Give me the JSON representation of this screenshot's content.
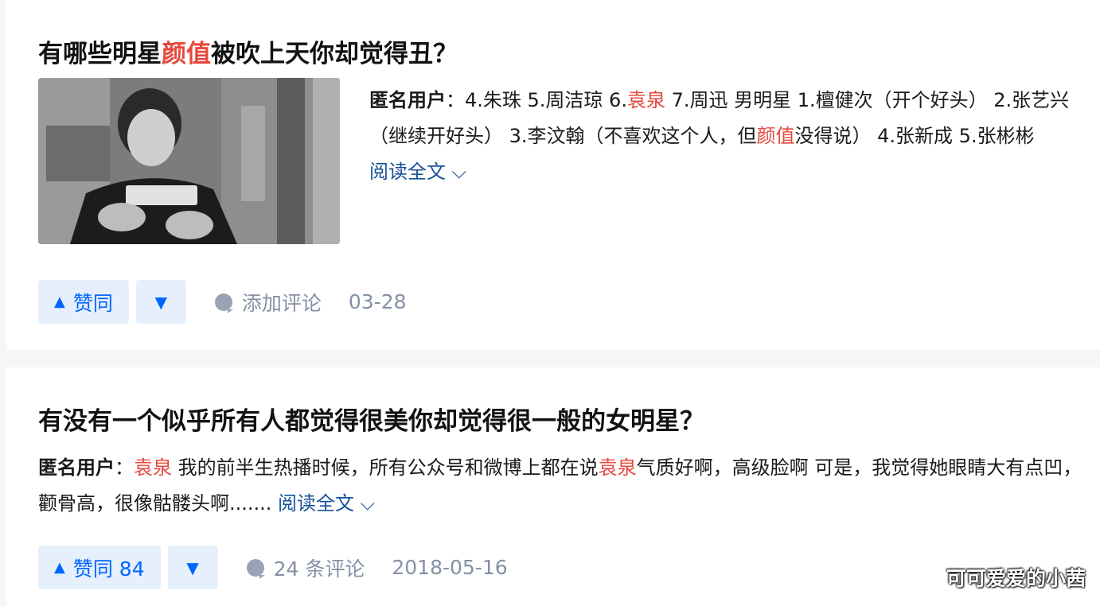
{
  "card1": {
    "title_pre": "有哪些明星",
    "title_hl": "颜值",
    "title_post": "被吹上天你却觉得丑？",
    "author": "匿名用户",
    "sep": "：",
    "excerpt_1": "4.朱珠 5.周洁琼 6.",
    "hl_1": "袁泉",
    "excerpt_2": " 7.周迅 男明星 1.檀健次（开个好头） 2.张艺兴（继续开好头） 3.李汶翰（不喜欢这个人，但",
    "hl_2": "颜值",
    "excerpt_3": "没得说） 4.张新成 5.张彬彬 ",
    "read_more": "阅读全文 ⌵",
    "vote_up": "赞同",
    "comment": "添加评论",
    "date": "03-28"
  },
  "card2": {
    "title": "有没有一个似乎所有人都觉得很美你却觉得很一般的女明星？",
    "author": "匿名用户",
    "sep": "：",
    "hl_1": "袁泉",
    "excerpt_1": " 我的前半生热播时候，所有公众号和微博上都在说",
    "hl_2": "袁泉",
    "excerpt_2": "气质好啊，高级脸啊 可是，我觉得她眼睛大有点凹，颧骨高，很像骷髅头啊....... ",
    "read_more": "阅读全文 ⌵",
    "vote_up": "赞同 84",
    "comment": "24 条评论",
    "date": "2018-05-16"
  },
  "icons": {
    "up": "▲",
    "down": "▼"
  },
  "watermark": "可可爱爱的小茜",
  "colors": {
    "highlight": "#e8473d",
    "link": "#175199",
    "vote_bg": "#e6f0fc",
    "vote_text": "#0066ff",
    "meta": "#8590a6"
  }
}
